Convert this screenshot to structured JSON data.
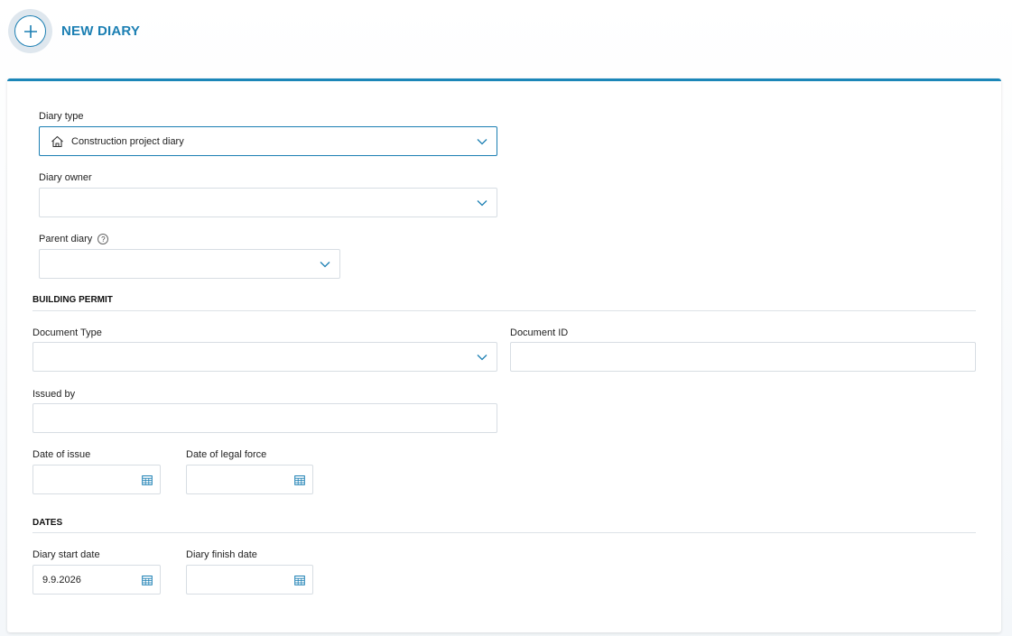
{
  "header": {
    "title": "NEW DIARY",
    "add_icon": "plus-circle-icon",
    "accent": "#1b7fb3"
  },
  "form": {
    "diary_type": {
      "label": "Diary type",
      "value": "Construction project diary",
      "icon": "house-icon"
    },
    "diary_owner": {
      "label": "Diary owner",
      "value": ""
    },
    "parent_diary": {
      "label": "Parent diary",
      "help_icon": "question-circle-icon",
      "value": ""
    },
    "building_permit": {
      "heading": "BUILDING PERMIT",
      "document_type": {
        "label": "Document Type",
        "value": ""
      },
      "document_id": {
        "label": "Document ID",
        "value": ""
      },
      "issued_by": {
        "label": "Issued by",
        "value": ""
      },
      "date_of_issue": {
        "label": "Date of issue",
        "value": ""
      },
      "date_of_legal_force": {
        "label": "Date of legal force",
        "value": ""
      }
    },
    "dates": {
      "heading": "DATES",
      "start": {
        "label": "Diary start date",
        "value": "9.9.2026"
      },
      "finish": {
        "label": "Diary finish date",
        "value": ""
      }
    }
  }
}
